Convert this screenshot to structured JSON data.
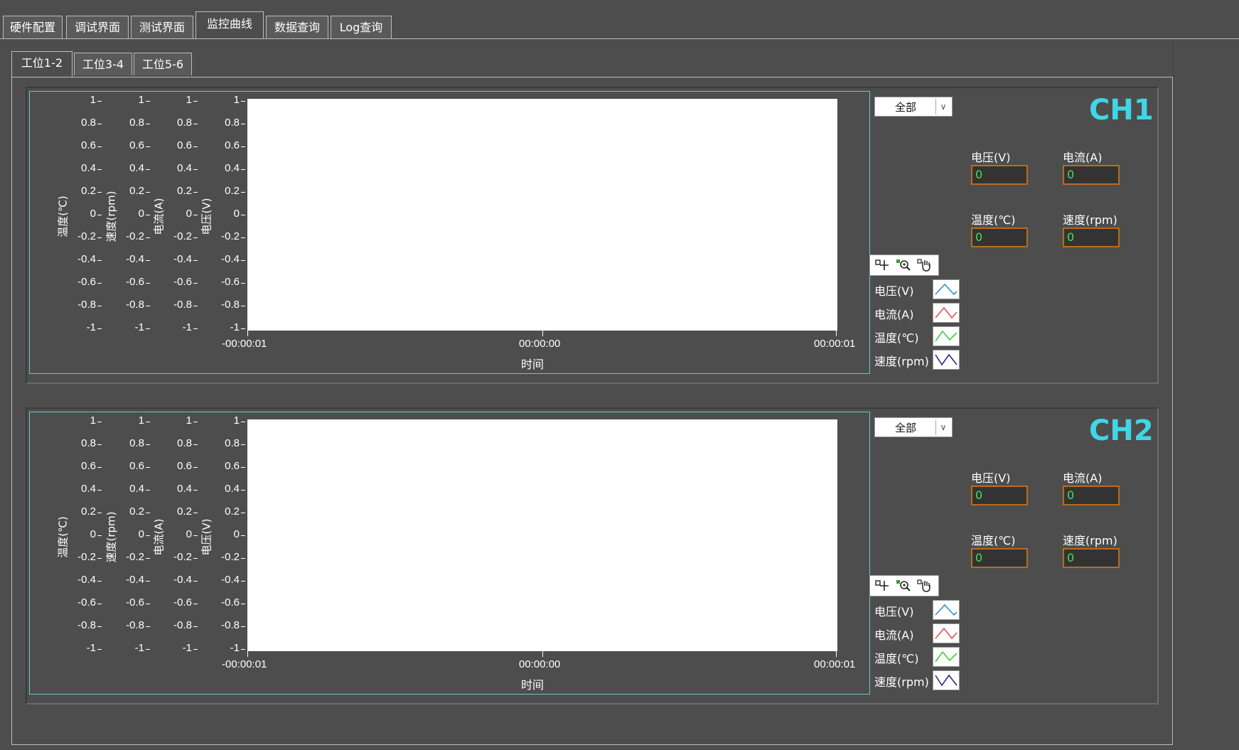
{
  "main_tabs": [
    "硬件配置",
    "调试界面",
    "测试界面",
    "监控曲线",
    "数据查询",
    "Log查询"
  ],
  "active_main_tab": "监控曲线",
  "sub_tabs": [
    "工位1-2",
    "工位3-4",
    "工位5-6"
  ],
  "active_sub_tab": "工位1-2",
  "channels": [
    {
      "title": "CH1",
      "dropdown_value": "全部",
      "y_axes": [
        "温度(℃)",
        "速度(rpm)",
        "电流(A)",
        "电压(V)"
      ],
      "y_ticks": [
        "1",
        "0.8",
        "0.6",
        "0.4",
        "0.2",
        "0",
        "-0.2",
        "-0.4",
        "-0.6",
        "-0.8",
        "-1"
      ],
      "x_ticks": [
        "-00:00:01",
        "00:00:00",
        "00:00:01"
      ],
      "x_label": "时间",
      "indicators": [
        {
          "label": "电压(V)",
          "value": "0"
        },
        {
          "label": "电流(A)",
          "value": "0"
        },
        {
          "label": "温度(℃)",
          "value": "0"
        },
        {
          "label": "速度(rpm)",
          "value": "0"
        }
      ],
      "legend": [
        {
          "label": "电压(V)",
          "color": "#2a8fd6"
        },
        {
          "label": "电流(A)",
          "color": "#e05050"
        },
        {
          "label": "温度(℃)",
          "color": "#3ccf3c"
        },
        {
          "label": "速度(rpm)",
          "color": "#2a2a8c"
        }
      ]
    },
    {
      "title": "CH2",
      "dropdown_value": "全部",
      "y_axes": [
        "温度(℃)",
        "速度(rpm)",
        "电流(A)",
        "电压(V)"
      ],
      "y_ticks": [
        "1",
        "0.8",
        "0.6",
        "0.4",
        "0.2",
        "0",
        "-0.2",
        "-0.4",
        "-0.6",
        "-0.8",
        "-1"
      ],
      "x_ticks": [
        "-00:00:01",
        "00:00:00",
        "00:00:01"
      ],
      "x_label": "时间",
      "indicators": [
        {
          "label": "电压(V)",
          "value": "0"
        },
        {
          "label": "电流(A)",
          "value": "0"
        },
        {
          "label": "温度(℃)",
          "value": "0"
        },
        {
          "label": "速度(rpm)",
          "value": "0"
        }
      ],
      "legend": [
        {
          "label": "电压(V)",
          "color": "#2a8fd6"
        },
        {
          "label": "电流(A)",
          "color": "#e05050"
        },
        {
          "label": "温度(℃)",
          "color": "#3ccf3c"
        },
        {
          "label": "速度(rpm)",
          "color": "#2a2a8c"
        }
      ]
    }
  ],
  "colors": {
    "background": "#4d4d4d",
    "channel_title": "#3fd6e6",
    "indicator_value": "#46e05a",
    "indicator_border": "#b86d1f",
    "graph_border": "#6cc6cc"
  }
}
